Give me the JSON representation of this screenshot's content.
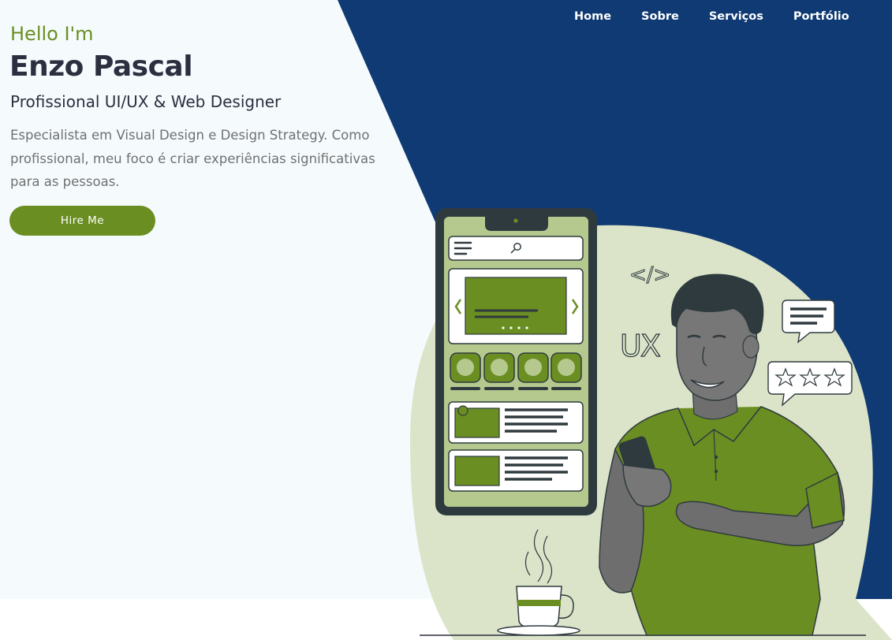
{
  "nav": {
    "items": [
      {
        "label": "Home"
      },
      {
        "label": "Sobre"
      },
      {
        "label": "Serviços"
      },
      {
        "label": "Portfólio"
      }
    ]
  },
  "hero": {
    "greeting": "Hello I'm",
    "name": "Enzo Pascal",
    "role": "Profissional UI/UX & Web Designer",
    "description": "Especialista em Visual Design e Design Strategy. Como profissional, meu foco é criar experiências significativas para as pessoas.",
    "cta_label": "Hire Me"
  },
  "illustration": {
    "code_tag": "</>",
    "ux_text": "UX",
    "star_count": 3
  },
  "colors": {
    "navy": "#0f3a73",
    "accent_green": "#6b8e23",
    "light_bg": "#f5fbfd",
    "blob": "#dbe4c8",
    "text_dark": "#2b2f3f",
    "text_muted": "#707070"
  }
}
